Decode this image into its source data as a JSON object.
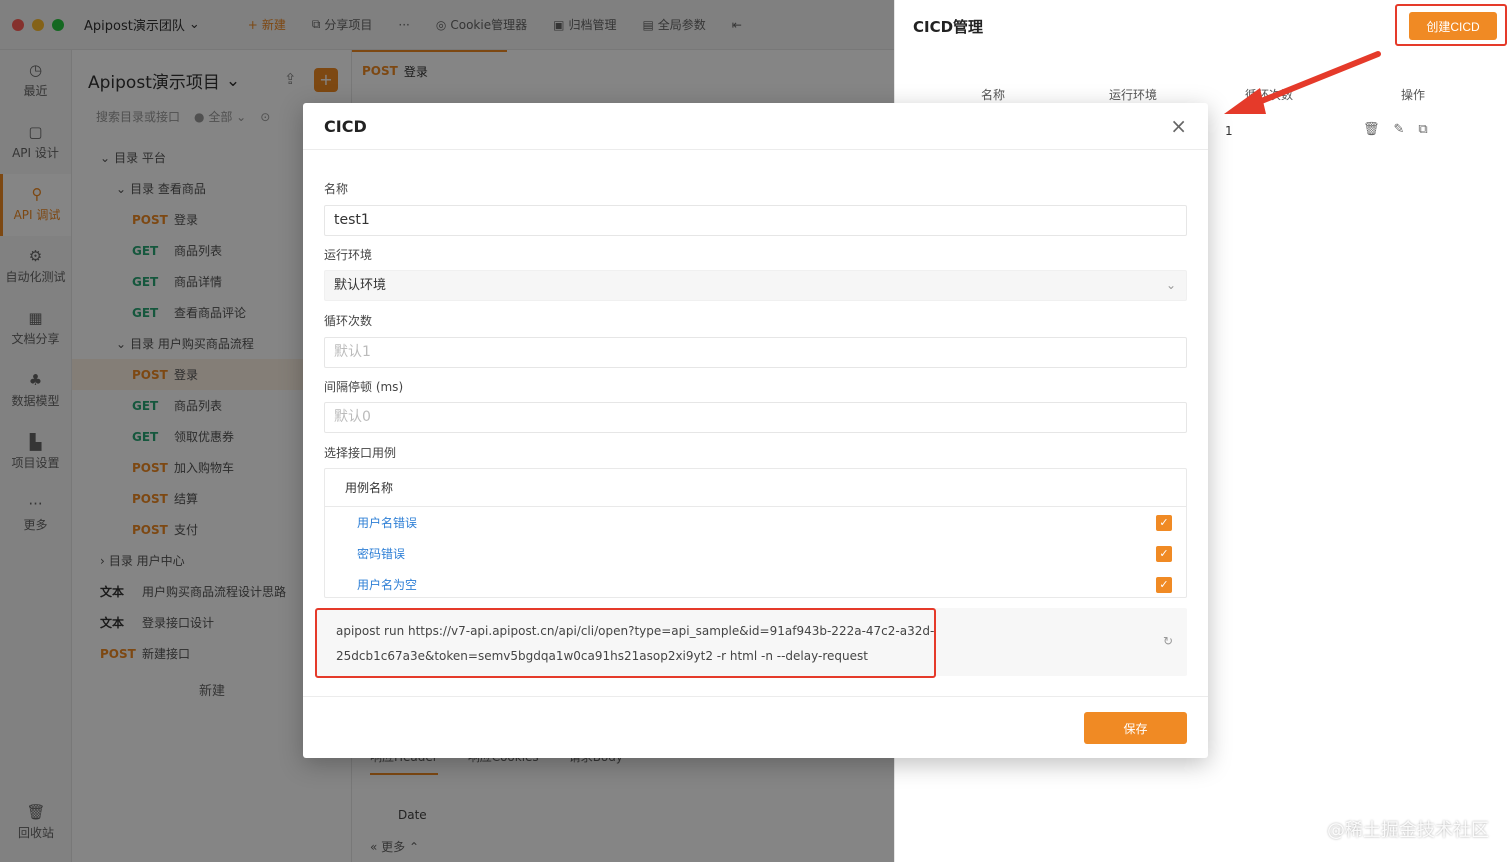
{
  "window": {
    "team": "Apipost演示团队",
    "nav": {
      "new": "新建",
      "share": "分享项目",
      "more": "···",
      "cookie": "Cookie管理器",
      "archive": "归档管理",
      "global": "全局参数"
    }
  },
  "rail": [
    {
      "label": "最近",
      "icon": "clock-icon"
    },
    {
      "label": "API 设计",
      "icon": "api-design-icon"
    },
    {
      "label": "API 调试",
      "icon": "api-debug-icon"
    },
    {
      "label": "自动化测试",
      "icon": "automation-icon"
    },
    {
      "label": "文档分享",
      "icon": "doc-share-icon"
    },
    {
      "label": "数据模型",
      "icon": "data-model-icon"
    },
    {
      "label": "项目设置",
      "icon": "project-settings-icon"
    },
    {
      "label": "更多",
      "icon": "more-icon"
    }
  ],
  "rail_bottom": {
    "label": "回收站",
    "icon": "trash-icon"
  },
  "project": {
    "title": "Apipost演示项目",
    "search_placeholder": "搜索目录或接口",
    "filter": "全部",
    "tree": [
      {
        "method": "",
        "label": "目录  平台",
        "indent": 1
      },
      {
        "method": "",
        "label": "目录  查看商品",
        "indent": 2
      },
      {
        "method": "POST",
        "label": "登录",
        "indent": 3
      },
      {
        "method": "GET",
        "label": "商品列表",
        "indent": 3
      },
      {
        "method": "GET",
        "label": "商品详情",
        "indent": 3
      },
      {
        "method": "GET",
        "label": "查看商品评论",
        "indent": 3
      },
      {
        "method": "",
        "label": "目录  用户购买商品流程",
        "indent": 2
      },
      {
        "method": "POST",
        "label": "登录",
        "indent": 3,
        "selected": true
      },
      {
        "method": "GET",
        "label": "商品列表",
        "indent": 3
      },
      {
        "method": "GET",
        "label": "领取优惠券",
        "indent": 3
      },
      {
        "method": "POST",
        "label": "加入购物车",
        "indent": 3
      },
      {
        "method": "POST",
        "label": "结算",
        "indent": 3
      },
      {
        "method": "POST",
        "label": "支付",
        "indent": 3
      },
      {
        "method": "",
        "label": "目录  用户中心",
        "indent": 1
      },
      {
        "method": "文本",
        "label": "用户购买商品流程设计思路",
        "indent": 1
      },
      {
        "method": "文本",
        "label": "登录接口设计",
        "indent": 1
      },
      {
        "method": "POST",
        "label": "新建接口",
        "indent": 0
      }
    ],
    "new_label": "新建"
  },
  "work": {
    "tab_method": "POST",
    "tab_label": "登录",
    "resp_tabs": [
      "响应Header",
      "响应Cookies",
      "请求Body"
    ],
    "resp_date": "Date",
    "more": "更多"
  },
  "panel": {
    "title": "CICD管理",
    "create_button": "创建CICD",
    "columns": [
      "名称",
      "运行环境",
      "循环次数",
      "操作"
    ],
    "row_value": "1"
  },
  "modal": {
    "title": "CICD",
    "fields": {
      "name_label": "名称",
      "name_value": "test1",
      "env_label": "运行环境",
      "env_value": "默认环境",
      "loop_label": "循环次数",
      "loop_placeholder": "默认1",
      "interval_label": "间隔停顿 (ms)",
      "interval_placeholder": "默认0",
      "cases_label": "选择接口用例"
    },
    "cases_header": "用例名称",
    "cases": [
      {
        "name": "用户名错误",
        "checked": true
      },
      {
        "name": "密码错误",
        "checked": true
      },
      {
        "name": "用户名为空",
        "checked": true
      }
    ],
    "command": "apipost run https://v7-api.apipost.cn/api/cli/open?type=api_sample&id=91af943b-222a-47c2-a32d-25dcb1c67a3e&token=semv5bgdqa1w0ca91hs21asop2xi9yt2 -r html -n --delay-request",
    "save_button": "保存"
  },
  "watermark": "@稀土掘金技术社区",
  "colors": {
    "accent": "#f08a24",
    "highlight": "#e53a2a",
    "link": "#2e7fd6"
  }
}
